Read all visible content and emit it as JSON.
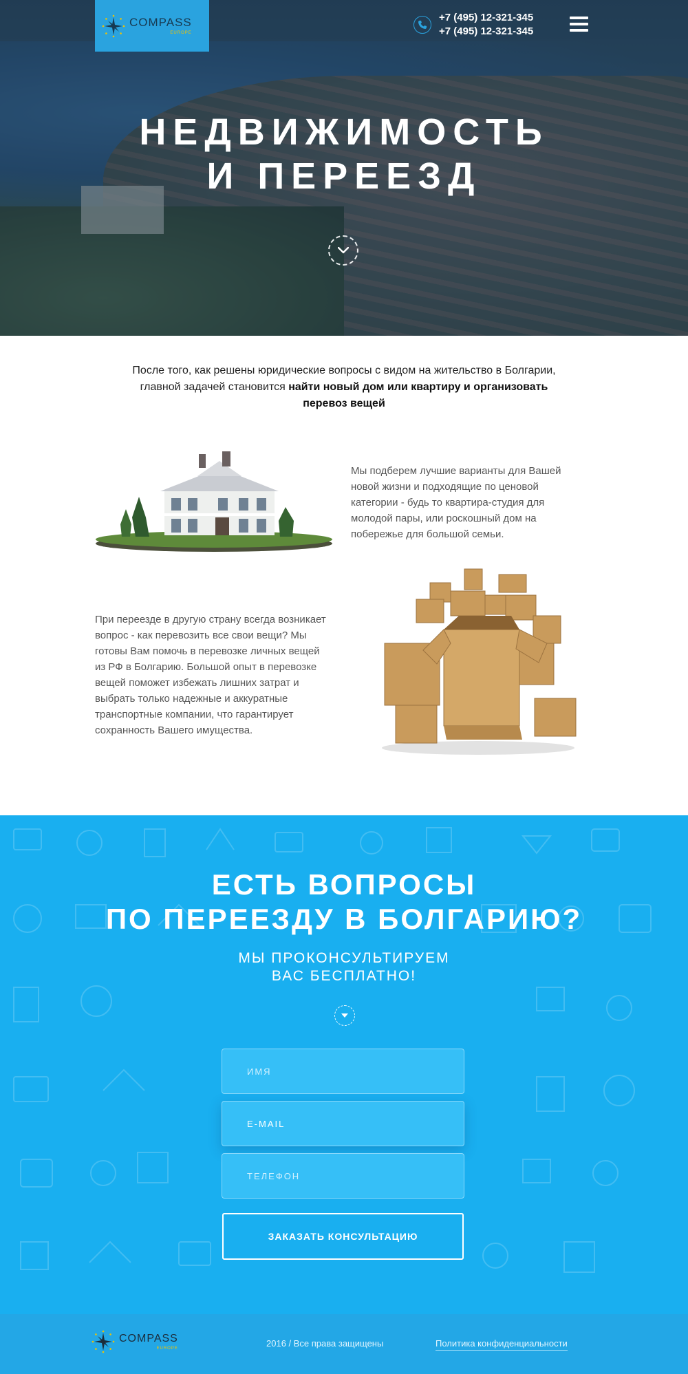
{
  "brand": {
    "name": "COMPASS",
    "sub": "EUROPE"
  },
  "header": {
    "phones": [
      "+7 (495) 12-321-345",
      "+7 (495) 12-321-345"
    ],
    "menu_icon": "hamburger-menu-icon"
  },
  "hero": {
    "title_line1": "НЕДВИЖИМОСТЬ",
    "title_line2": "И ПЕРЕЕЗД"
  },
  "intro": {
    "line1": "После того, как решены юридические вопросы с видом на жительство в Болгарии,",
    "line2_plain": "главной задачей становится ",
    "line2_bold": "найти новый дом или квартиру и организовать",
    "line3_bold": "перевоз вещей"
  },
  "features": {
    "housing_text": "Мы подберем лучшие варианты для Вашей новой жизни и подходящие по ценовой категории - будь то квартира-студия для молодой пары, или роскошный дом на побережье для большой семьи.",
    "moving_text": "При переезде в другую страну всегда возникает вопрос - как перевозить все свои вещи? Мы готовы Вам помочь в перевозке личных вещей из РФ в Болгарию. Большой опыт в перевозке вещей поможет избежать лишних затрат и выбрать только надежные и аккуратные транспортные компании, что гарантирует сохранность Вашего имущества."
  },
  "cta": {
    "title_line1": "ЕСТЬ ВОПРОСЫ",
    "title_line2": "ПО ПЕРЕЕЗДУ В БОЛГАРИЮ?",
    "sub_line1": "МЫ ПРОКОНСУЛЬТИРУЕМ",
    "sub_line2": "ВАС БЕСПЛАТНО!",
    "form": {
      "name_placeholder": "ИМЯ",
      "email_placeholder": "E-MAIL",
      "phone_placeholder": "ТЕЛЕФОН",
      "submit_label": "ЗАКАЗАТЬ КОНСУЛЬТАЦИЮ"
    }
  },
  "footer": {
    "copyright": "2016 / Все права защищены",
    "privacy_link": "Политика конфиденциальности"
  },
  "colors": {
    "accent": "#19aff0",
    "logo_bg": "#2aa3df",
    "footer": "#23a7e6",
    "star_dots": "#f2c300"
  }
}
